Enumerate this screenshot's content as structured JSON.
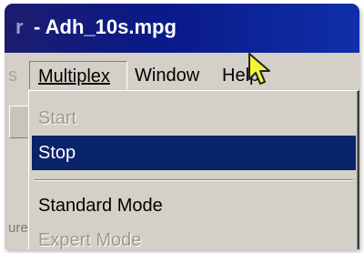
{
  "window": {
    "title_prefix": "r",
    "title": "- Adh_10s.mpg"
  },
  "menubar": {
    "items": [
      {
        "label": "Multiplex",
        "open": true
      },
      {
        "label": "Window"
      },
      {
        "label": "Help"
      }
    ]
  },
  "background_fragments": {
    "status_text": "ure"
  },
  "dropdown": {
    "items": [
      {
        "label": "Start",
        "enabled": false
      },
      {
        "label": "Stop",
        "enabled": true,
        "highlighted": true
      },
      {
        "label": "Standard Mode",
        "enabled": true
      },
      {
        "label": "Expert Mode",
        "enabled": false
      }
    ]
  },
  "colors": {
    "title_bar": "#0a1a8a",
    "selection": "#0a246a",
    "menu_bg": "#d4d0c8",
    "cursor": "#f5f530"
  },
  "cursor": {
    "icon": "arrow-cursor-icon"
  }
}
